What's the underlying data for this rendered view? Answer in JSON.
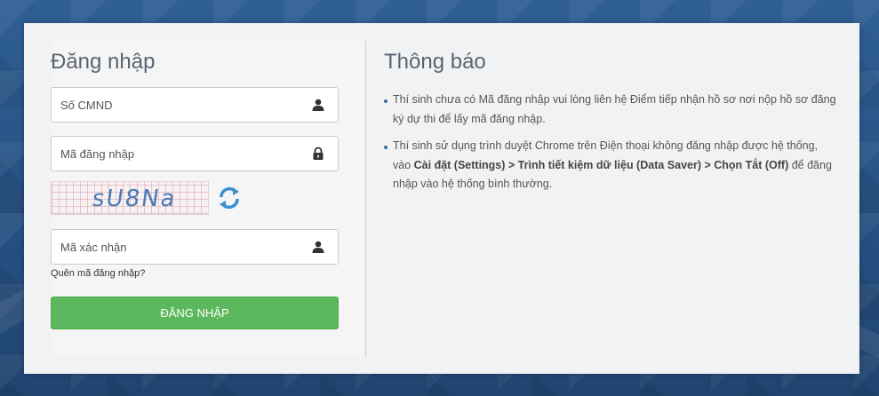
{
  "login": {
    "title": "Đăng nhập",
    "id_placeholder": "Số CMND",
    "code_placeholder": "Mã đăng nhập",
    "captcha_text": "sU8Na",
    "verify_placeholder": "Mã xác nhận",
    "forgot_link": "Quên mã đăng nhập?",
    "submit_label": "ĐĂNG NHẬP"
  },
  "notice": {
    "title": "Thông báo",
    "item1": "Thí sinh chưa có Mã đăng nhập vui lòng liên hệ Điểm tiếp nhận hồ sơ nơi nộp hồ sơ đăng ký dự thi để lấy mã đăng nhập.",
    "item2_pre": "Thí sinh sử dụng trình duyệt Chrome trên Điện thoại không đăng nhập được hệ thống, vào ",
    "item2_bold": "Cài đặt (Settings) > Trình tiết kiệm dữ liệu (Data Saver) > Chọn Tắt (Off)",
    "item2_post": " để đăng nhập vào hệ thống bình thường."
  },
  "colors": {
    "button": "#5cb85c",
    "background": "#2d5a8e",
    "card": "#f1f2f3"
  }
}
